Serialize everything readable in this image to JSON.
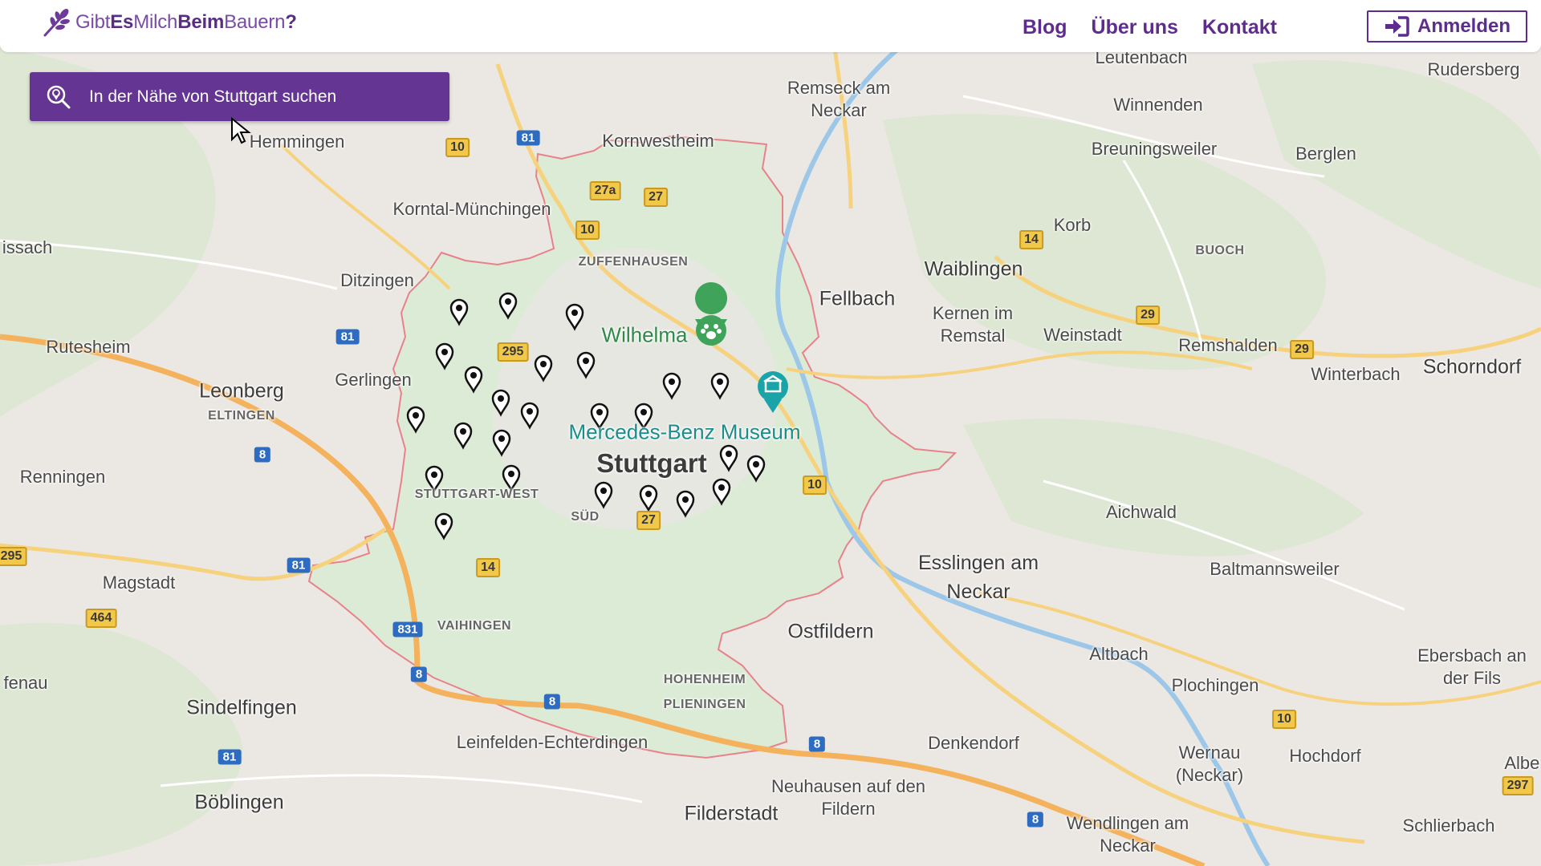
{
  "header": {
    "logo_parts": [
      "Gibt",
      "Es",
      "Milch",
      "Beim",
      "Bauern",
      "?"
    ],
    "nav": [
      "Blog",
      "Über uns",
      "Kontakt"
    ],
    "login_label": "Anmelden"
  },
  "search": {
    "placeholder": "In der Nähe von Stuttgart suchen"
  },
  "map": {
    "cities_large": [
      "Stuttgart"
    ],
    "cities": [
      "Leonberg",
      "Sindelfingen",
      "Böblingen",
      "Waiblingen",
      "Fellbach",
      "Esslingen am Neckar",
      "Ostfildern",
      "Filderstadt",
      "Leinfelden-Echterdingen",
      "Kornwestheim",
      "Gerlingen",
      "Ditzingen",
      "Schorndorf",
      "Plochingen",
      "Winnenden",
      "Remseck am Neckar",
      "Korntal-Münchingen",
      "Weinstadt"
    ],
    "towns": [
      "Rutesheim",
      "Renningen",
      "Magstadt",
      "Hemmingen",
      "Remshalden",
      "Winterbach",
      "Kernen im Remstal",
      "Berglen",
      "Breuningsweiler",
      "Korb",
      "Leutenbach",
      "Rudersberg",
      "Aichwald",
      "Baltmannsweiler",
      "Altbach",
      "Ebersbach an der Fils",
      "Denkendorf",
      "Neuhausen auf den Fildern",
      "Wernau (Neckar)",
      "Hochdorf",
      "Wendlingen am Neckar",
      "Schlierbach",
      "issach",
      "fenau",
      "Alber"
    ],
    "districts": [
      "ZUFFENHAUSEN",
      "STUTTGART-WEST",
      "SÜD",
      "VAIHINGEN",
      "HOHENHEIM",
      "PLIENINGEN",
      "ELTINGEN",
      "BUOCH"
    ],
    "pois": [
      "Wilhelma",
      "Mercedes-Benz Museum"
    ],
    "road_numbers": [
      "10",
      "27a",
      "27",
      "295",
      "14",
      "29",
      "81",
      "8",
      "831",
      "464",
      "297"
    ],
    "marker_count": 24,
    "colors": {
      "brand": "#653593",
      "city_area": "#dcebd6",
      "boundary": "#e8828a",
      "highway": "#f5c76a",
      "marker": "#111111"
    }
  }
}
